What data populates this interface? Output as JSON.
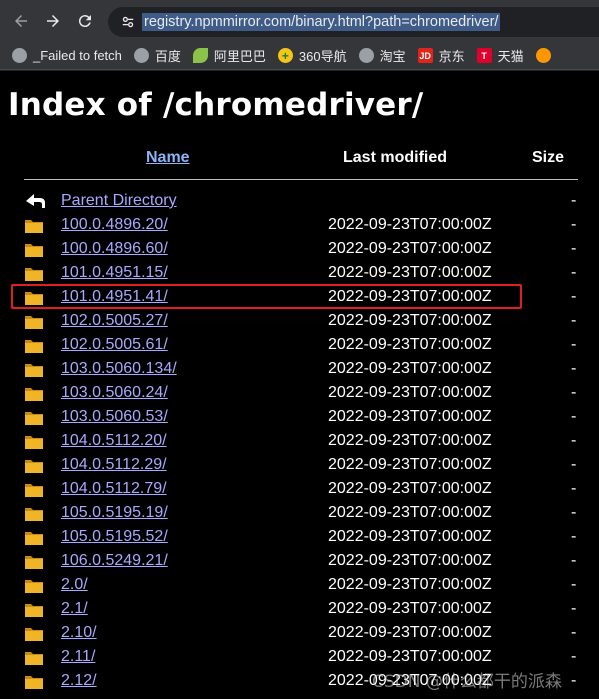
{
  "browser": {
    "url": "registry.npmmirror.com/binary.html?path=chromedriver/",
    "bookmarks": [
      {
        "label": "_Failed to fetch",
        "icon": "globe-icon"
      },
      {
        "label": "百度",
        "icon": "globe-icon"
      },
      {
        "label": "阿里巴巴",
        "icon": "leaf-icon"
      },
      {
        "label": "360导航",
        "icon": "360-icon"
      },
      {
        "label": "淘宝",
        "icon": "globe-icon"
      },
      {
        "label": "京东",
        "icon": "jd-icon"
      },
      {
        "label": "天猫",
        "icon": "tmall-icon"
      }
    ]
  },
  "page": {
    "title": "Index of /chromedriver/",
    "headers": {
      "name": "Name",
      "modified": "Last modified",
      "size": "Size"
    },
    "parent": {
      "name": "Parent Directory",
      "size": "-"
    },
    "rows": [
      {
        "name": "100.0.4896.20/",
        "modified": "2022-09-23T07:00:00Z",
        "size": "-"
      },
      {
        "name": "100.0.4896.60/",
        "modified": "2022-09-23T07:00:00Z",
        "size": "-"
      },
      {
        "name": "101.0.4951.15/",
        "modified": "2022-09-23T07:00:00Z",
        "size": "-"
      },
      {
        "name": "101.0.4951.41/",
        "modified": "2022-09-23T07:00:00Z",
        "size": "-"
      },
      {
        "name": "102.0.5005.27/",
        "modified": "2022-09-23T07:00:00Z",
        "size": "-"
      },
      {
        "name": "102.0.5005.61/",
        "modified": "2022-09-23T07:00:00Z",
        "size": "-"
      },
      {
        "name": "103.0.5060.134/",
        "modified": "2022-09-23T07:00:00Z",
        "size": "-"
      },
      {
        "name": "103.0.5060.24/",
        "modified": "2022-09-23T07:00:00Z",
        "size": "-"
      },
      {
        "name": "103.0.5060.53/",
        "modified": "2022-09-23T07:00:00Z",
        "size": "-"
      },
      {
        "name": "104.0.5112.20/",
        "modified": "2022-09-23T07:00:00Z",
        "size": "-"
      },
      {
        "name": "104.0.5112.29/",
        "modified": "2022-09-23T07:00:00Z",
        "size": "-"
      },
      {
        "name": "104.0.5112.79/",
        "modified": "2022-09-23T07:00:00Z",
        "size": "-"
      },
      {
        "name": "105.0.5195.19/",
        "modified": "2022-09-23T07:00:00Z",
        "size": "-"
      },
      {
        "name": "105.0.5195.52/",
        "modified": "2022-09-23T07:00:00Z",
        "size": "-"
      },
      {
        "name": "106.0.5249.21/",
        "modified": "2022-09-23T07:00:00Z",
        "size": "-"
      },
      {
        "name": "2.0/",
        "modified": "2022-09-23T07:00:00Z",
        "size": "-"
      },
      {
        "name": "2.1/",
        "modified": "2022-09-23T07:00:00Z",
        "size": "-"
      },
      {
        "name": "2.10/",
        "modified": "2022-09-23T07:00:00Z",
        "size": "-"
      },
      {
        "name": "2.11/",
        "modified": "2022-09-23T07:00:00Z",
        "size": "-"
      },
      {
        "name": "2.12/",
        "modified": "2022-09-23T07:00:00Z",
        "size": "-"
      }
    ],
    "highlighted_row": "101.0.4951.41/"
  },
  "watermark": "CSDN @什么都干的派森",
  "colors": {
    "link": "#a8a8ff",
    "header_link": "#8ab4f8",
    "highlight": "#e02020",
    "folder": "#e6a817"
  }
}
